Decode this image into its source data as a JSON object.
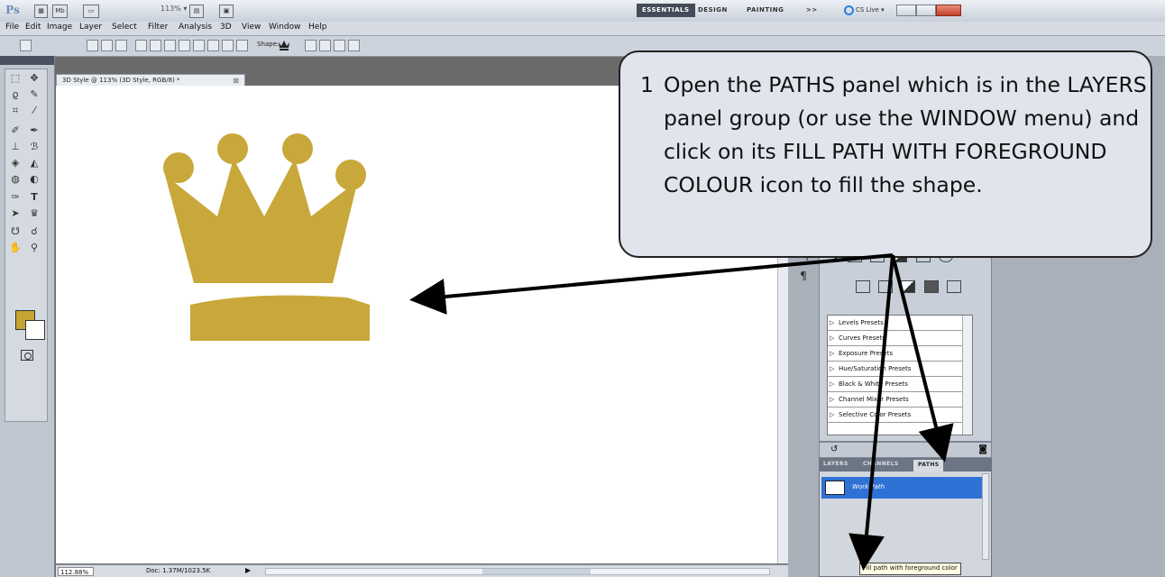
{
  "app": {
    "logo": "Ps",
    "zoom_select": "113%",
    "workspaces": [
      "ESSENTIALS",
      "DESIGN",
      "PAINTING"
    ],
    "active_workspace": "ESSENTIALS",
    "more": ">>",
    "cs_live": "CS Live"
  },
  "menu": [
    "File",
    "Edit",
    "Image",
    "Layer",
    "Select",
    "Filter",
    "Analysis",
    "3D",
    "View",
    "Window",
    "Help"
  ],
  "options": {
    "shape_label": "Shape:"
  },
  "document": {
    "tab_title": "3D Style @ 113% (3D Style, RGB/8) *",
    "zoom": "112.88%",
    "doc_info": "Doc: 1.37M/1023.5K"
  },
  "colors": {
    "foreground": "#c5a534",
    "background": "#ffffff",
    "crown": "#c8a83a",
    "accent": "#2f72d6"
  },
  "adjustments": {
    "presets": [
      "Levels Presets",
      "Curves Presets",
      "Exposure Presets",
      "Hue/Saturation Presets",
      "Black & White Presets",
      "Channel Mixer Presets",
      "Selective Color Presets"
    ]
  },
  "layers_group": {
    "tabs": [
      "LAYERS",
      "CHANNELS",
      "PATHS"
    ],
    "active_tab": "PATHS",
    "path_name": "Work Path",
    "tooltip": "Fill path with foreground color"
  },
  "callout": {
    "step": "1",
    "text": "Open the PATHS panel which is in the LAYERS panel group (or use the WINDOW menu) and click on its FILL PATH WITH FOREGROUND COLOUR icon to fill the shape."
  }
}
